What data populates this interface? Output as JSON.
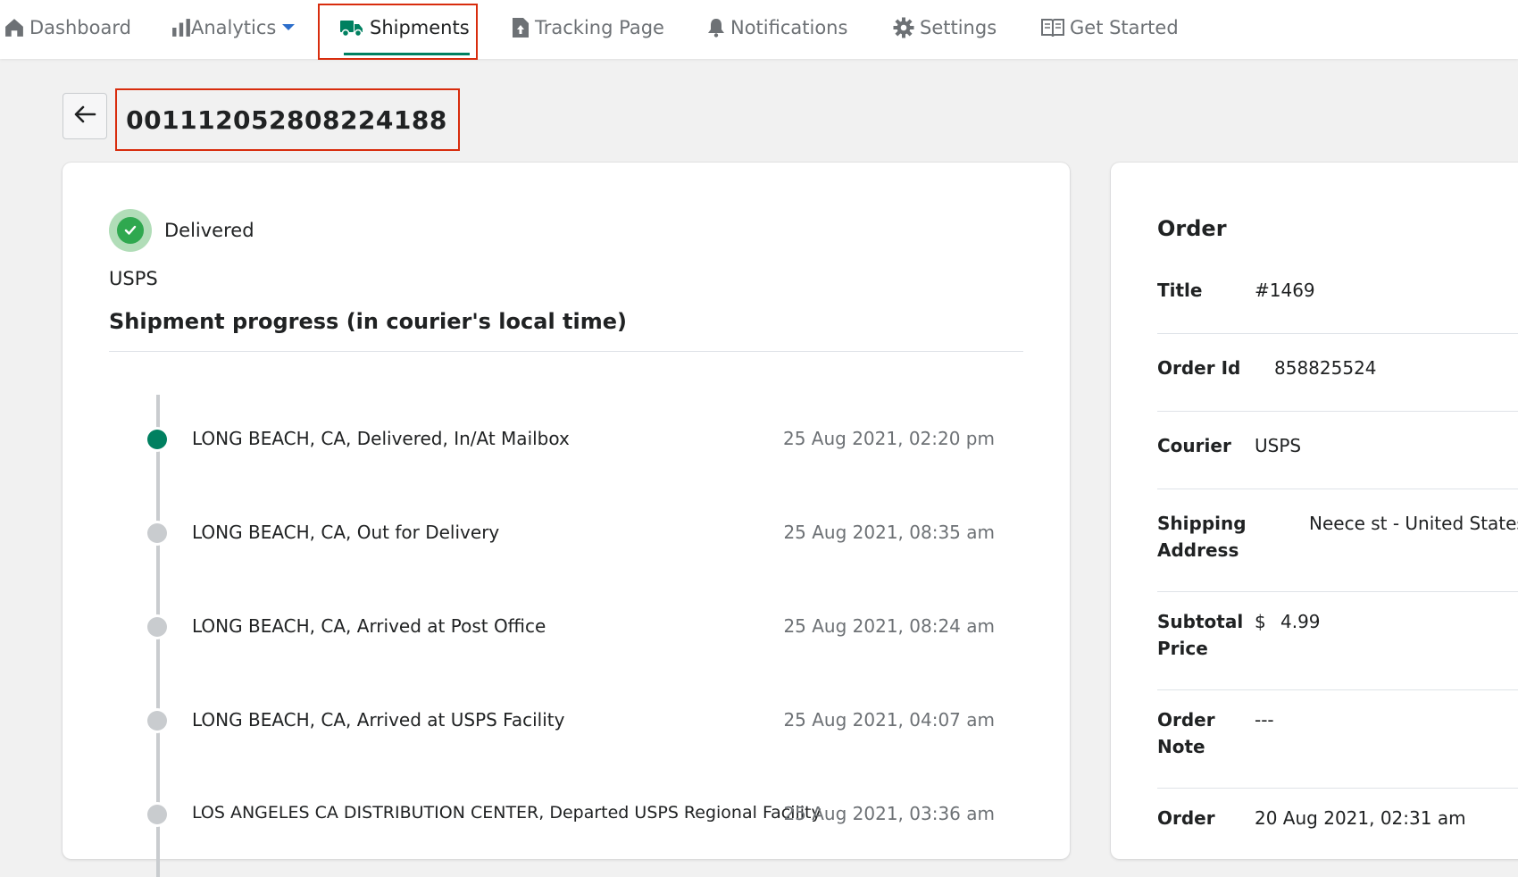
{
  "nav": {
    "dashboard": "Dashboard",
    "analytics": "Analytics",
    "shipments": "Shipments",
    "tracking_page": "Tracking Page",
    "notifications": "Notifications",
    "settings": "Settings",
    "get_started": "Get Started",
    "active": "Shipments",
    "accent_color": "#008060"
  },
  "shipment": {
    "tracking_number": "001112052808224188",
    "status": "Delivered",
    "courier": "USPS",
    "progress_heading": "Shipment progress (in courier's local time)",
    "events": [
      {
        "description": "LONG BEACH, CA, Delivered, In/At Mailbox",
        "time": "25 Aug 2021, 02:20 pm"
      },
      {
        "description": "LONG BEACH, CA, Out for Delivery",
        "time": "25 Aug 2021, 08:35 am"
      },
      {
        "description": "LONG BEACH, CA, Arrived at Post Office",
        "time": "25 Aug 2021, 08:24 am"
      },
      {
        "description": "LONG BEACH, CA, Arrived at USPS Facility",
        "time": "25 Aug 2021, 04:07 am"
      },
      {
        "description": "LOS ANGELES CA DISTRIBUTION CENTER, Departed USPS Regional Facility",
        "time": "25 Aug 2021, 03:36 am"
      }
    ]
  },
  "order": {
    "heading": "Order",
    "title_label": "Title",
    "title_value": "#1469",
    "order_id_label": "Order Id",
    "order_id_value": "858825524",
    "courier_label": "Courier",
    "courier_value": "USPS",
    "shipping_address_label": "Shipping Address",
    "shipping_address_value": "Neece st - United States",
    "subtotal_label": "Subtotal Price",
    "subtotal_currency": "$",
    "subtotal_value": "4.99",
    "note_label": "Order Note",
    "note_value": "---",
    "order_date_label": "Order",
    "order_date_value": "20 Aug 2021, 02:31 am"
  }
}
